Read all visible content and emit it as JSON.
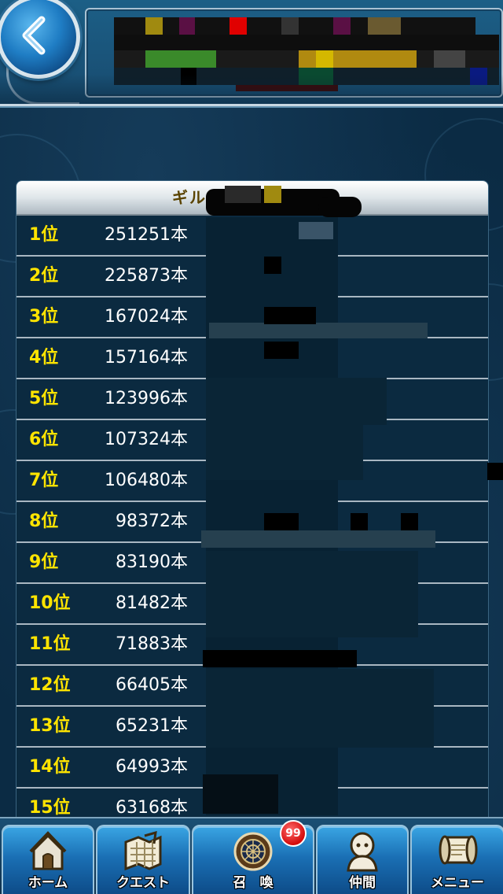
{
  "ranking": {
    "title": "ギル",
    "rows": [
      {
        "rank": "1位",
        "count": "251251本"
      },
      {
        "rank": "2位",
        "count": "225873本"
      },
      {
        "rank": "3位",
        "count": "167024本"
      },
      {
        "rank": "4位",
        "count": "157164本"
      },
      {
        "rank": "5位",
        "count": "123996本"
      },
      {
        "rank": "6位",
        "count": "107324本"
      },
      {
        "rank": "7位",
        "count": "106480本"
      },
      {
        "rank": "8位",
        "count": "98372本"
      },
      {
        "rank": "9位",
        "count": "83190本"
      },
      {
        "rank": "10位",
        "count": "81482本"
      },
      {
        "rank": "11位",
        "count": "71883本"
      },
      {
        "rank": "12位",
        "count": "66405本"
      },
      {
        "rank": "13位",
        "count": "65231本"
      },
      {
        "rank": "14位",
        "count": "64993本"
      },
      {
        "rank": "15位",
        "count": "63168本"
      }
    ]
  },
  "nav": {
    "home": "ホーム",
    "quest": "クエスト",
    "summon": "召　喚",
    "summon_badge": "99",
    "friends": "仲間",
    "menu": "メニュー"
  },
  "colors": {
    "rank_text": "#ffe400",
    "count_text": "#ffffff",
    "panel_bg": "#0b2a40",
    "title_text": "#5a4300"
  },
  "icons": {
    "back": "back-arrow-icon",
    "home": "home-icon",
    "quest": "map-icon",
    "summon": "summon-circle-icon",
    "friends": "person-icon",
    "menu": "scroll-icon"
  }
}
